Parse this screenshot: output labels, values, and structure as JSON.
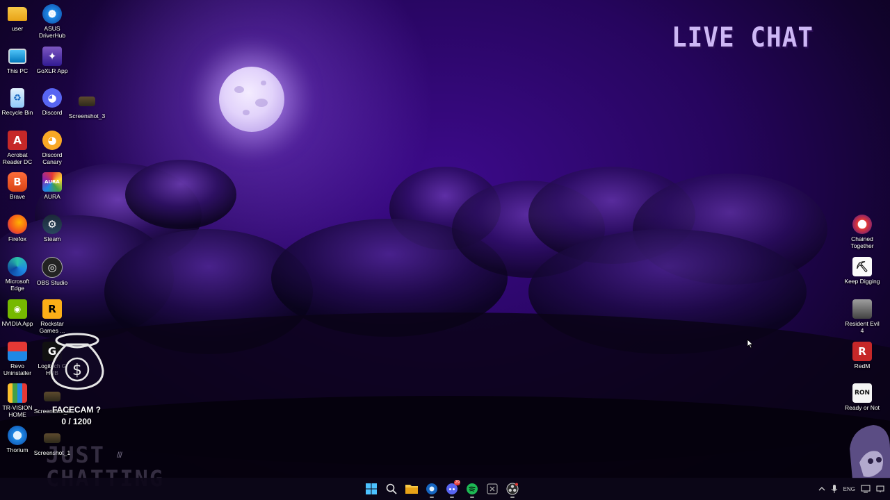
{
  "overlay": {
    "live_chat": "LIVE CHAT",
    "facecam_goal": "FACECAM ?",
    "facecam_progress": "0 / 1200",
    "scene_label": "JUST\nCHATTING",
    "scene_arrows": "///"
  },
  "desktop_icons_left": [
    {
      "label": "user",
      "icon": "folder-icon"
    },
    {
      "label": "ASUS DriverHub",
      "icon": "gear-icon"
    },
    {
      "label": "This PC",
      "icon": "monitor-icon"
    },
    {
      "label": "GoXLR App",
      "icon": "goxlr-icon"
    },
    {
      "label": "Recycle Bin",
      "icon": "recycle-bin-icon"
    },
    {
      "label": "Discord",
      "icon": "discord-icon"
    },
    {
      "label": "Screenshot_3",
      "icon": "screenshot-icon"
    },
    {
      "label": "Acrobat Reader DC",
      "icon": "acrobat-icon"
    },
    {
      "label": "Discord Canary",
      "icon": "discord-canary-icon"
    },
    {
      "label": "Brave",
      "icon": "brave-icon"
    },
    {
      "label": "AURA",
      "icon": "aura-icon"
    },
    {
      "label": "Firefox",
      "icon": "firefox-icon"
    },
    {
      "label": "Steam",
      "icon": "steam-icon"
    },
    {
      "label": "Microsoft Edge",
      "icon": "edge-icon"
    },
    {
      "label": "OBS Studio",
      "icon": "obs-icon"
    },
    {
      "label": "NVIDIA App",
      "icon": "nvidia-icon"
    },
    {
      "label": "Rockstar Games ...",
      "icon": "rockstar-icon"
    },
    {
      "label": "Revo Uninstaller",
      "icon": "revo-icon"
    },
    {
      "label": "Logitech G HUB",
      "icon": "logitech-icon"
    },
    {
      "label": "TR-VISION HOME",
      "icon": "trvision-icon"
    },
    {
      "label": "Screenshot_2",
      "icon": "screenshot-icon"
    },
    {
      "label": "Thorium",
      "icon": "thorium-icon"
    },
    {
      "label": "Screenshot_1",
      "icon": "screenshot-icon"
    }
  ],
  "desktop_icons_right": [
    {
      "label": "Chained Together",
      "icon": "chained-together-icon"
    },
    {
      "label": "Keep Digging",
      "icon": "keep-digging-icon"
    },
    {
      "label": "Resident Evil 4",
      "icon": "resident-evil-icon"
    },
    {
      "label": "RedM",
      "icon": "redm-icon"
    },
    {
      "label": "Ready or Not",
      "icon": "ready-or-not-icon"
    }
  ],
  "taskbar": {
    "apps": [
      "start-icon",
      "search-icon",
      "file-explorer-icon",
      "thorium-icon",
      "discord-icon",
      "spotify-icon",
      "excel-icon",
      "obs-icon"
    ],
    "discord_badge": "29",
    "tray": [
      "chevron-up-icon",
      "microphone-icon",
      "language-indicator",
      "display-icon",
      "network-icon"
    ],
    "language_text": "ENG"
  },
  "colors": {
    "accent_purple": "#3c0a8a",
    "live_chat_text": "#cdb7f5"
  }
}
